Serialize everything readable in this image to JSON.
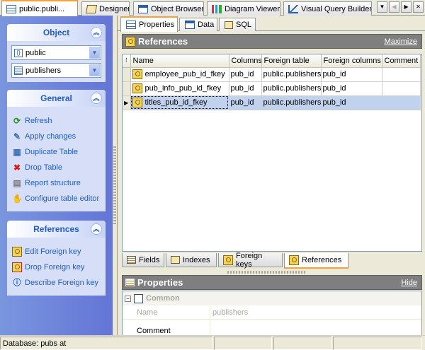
{
  "doc_tabs": [
    {
      "label": "public.publi...",
      "icon": "table-icon",
      "active": true
    },
    {
      "label": "Designer",
      "icon": "designer-icon"
    },
    {
      "label": "Object Browser",
      "icon": "object-browser-icon"
    },
    {
      "label": "Diagram Viewer",
      "icon": "diagram-viewer-icon"
    },
    {
      "label": "Visual Query Builder",
      "icon": "visual-query-builder-icon"
    }
  ],
  "nav": {
    "object_group": {
      "title": "Object",
      "schema_value": "public",
      "table_value": "publishers"
    },
    "general_group": {
      "title": "General",
      "items": [
        {
          "label": "Refresh",
          "icon": "refresh-icon"
        },
        {
          "label": "Apply changes",
          "icon": "apply-changes-icon"
        },
        {
          "label": "Duplicate Table",
          "icon": "duplicate-table-icon"
        },
        {
          "label": "Drop Table",
          "icon": "drop-table-icon"
        },
        {
          "label": "Report structure",
          "icon": "report-structure-icon"
        },
        {
          "label": "Configure table editor",
          "icon": "configure-icon"
        }
      ]
    },
    "references_group": {
      "title": "References",
      "items": [
        {
          "label": "Edit Foreign key",
          "icon": "edit-foreign-key-icon"
        },
        {
          "label": "Drop Foreign key",
          "icon": "drop-foreign-key-icon"
        },
        {
          "label": "Describe Foreign key",
          "icon": "info-icon"
        }
      ]
    }
  },
  "sub_tabs": [
    {
      "label": "Properties",
      "active": true
    },
    {
      "label": "Data"
    },
    {
      "label": "SQL"
    }
  ],
  "references_panel": {
    "title": "References",
    "maximize_label": "Maximize",
    "columns": [
      "Name",
      "Columns",
      "Foreign table",
      "Foreign columns",
      "Comment"
    ],
    "rows": [
      {
        "name": "employee_pub_id_fkey",
        "columns": "pub_id",
        "foreign_table": "public.publishers",
        "foreign_columns": "pub_id",
        "comment": ""
      },
      {
        "name": "pub_info_pub_id_fkey",
        "columns": "pub_id",
        "foreign_table": "public.publishers",
        "foreign_columns": "pub_id",
        "comment": ""
      },
      {
        "name": "titles_pub_id_fkey",
        "columns": "pub_id",
        "foreign_table": "public.publishers",
        "foreign_columns": "pub_id",
        "comment": "",
        "selected": true
      }
    ]
  },
  "bottom_tabs": [
    {
      "label": "Fields"
    },
    {
      "label": "Indexes"
    },
    {
      "label": "Foreign keys"
    },
    {
      "label": "References",
      "active": true
    }
  ],
  "properties_panel": {
    "title": "Properties",
    "hide_label": "Hide",
    "group_label": "Common",
    "rows": [
      {
        "key": "Name",
        "value": "publishers"
      },
      {
        "key": "Comment",
        "value": ""
      }
    ]
  },
  "status_bar": {
    "database_text": "Database: pubs at"
  }
}
